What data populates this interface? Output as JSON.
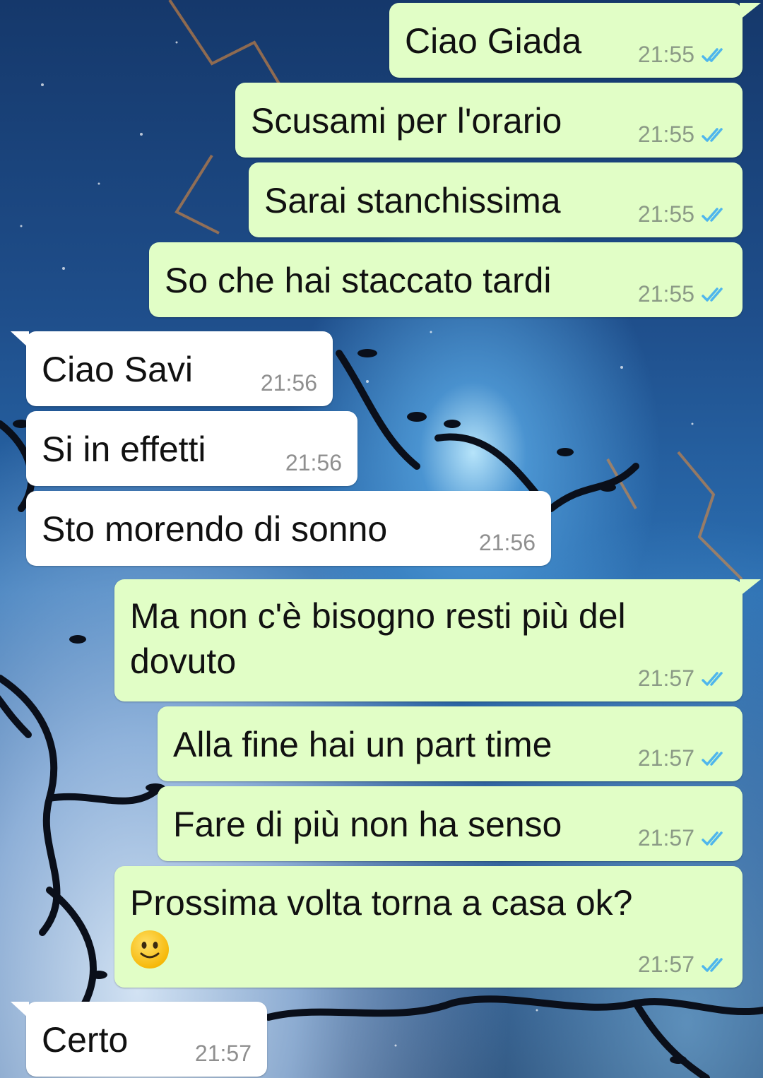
{
  "messages": [
    {
      "direction": "out",
      "text": "Ciao Giada",
      "time": "21:55",
      "status": "read"
    },
    {
      "direction": "out",
      "text": "Scusami per l'orario",
      "time": "21:55",
      "status": "read"
    },
    {
      "direction": "out",
      "text": "Sarai stanchissima",
      "time": "21:55",
      "status": "read"
    },
    {
      "direction": "out",
      "text": "So che hai staccato tardi",
      "time": "21:55",
      "status": "read"
    },
    {
      "direction": "in",
      "text": "Ciao Savi",
      "time": "21:56"
    },
    {
      "direction": "in",
      "text": "Si in effetti",
      "time": "21:56"
    },
    {
      "direction": "in",
      "text": "Sto morendo di sonno",
      "time": "21:56"
    },
    {
      "direction": "out",
      "text": "Ma non c'è bisogno resti più del\ndovuto",
      "time": "21:57",
      "status": "read"
    },
    {
      "direction": "out",
      "text": "Alla fine hai un part time",
      "time": "21:57",
      "status": "read"
    },
    {
      "direction": "out",
      "text": "Fare di più non ha senso",
      "time": "21:57",
      "status": "read"
    },
    {
      "direction": "out",
      "text": "Prossima volta torna a casa ok?",
      "emoji": "slightly-smiling-face-icon",
      "time": "21:57",
      "status": "read"
    },
    {
      "direction": "in",
      "text": "Certo",
      "time": "21:57"
    }
  ],
  "colors": {
    "outgoing_bubble": "#e1fec6",
    "incoming_bubble": "#ffffff",
    "read_ticks": "#4fb6ec"
  }
}
